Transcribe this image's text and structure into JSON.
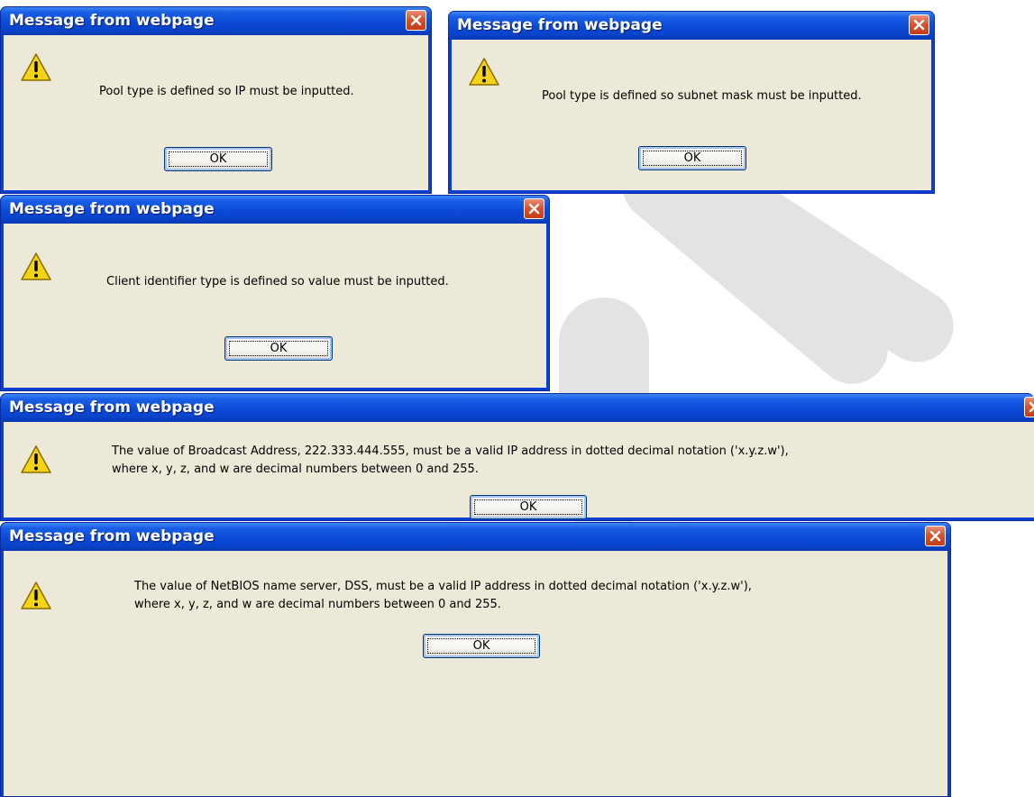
{
  "dialogs": [
    {
      "title": "Message from webpage",
      "message_lines": [
        "Pool type is defined so IP must be inputted."
      ],
      "ok_label": "OK"
    },
    {
      "title": "Message from webpage",
      "message_lines": [
        "Pool type is defined so subnet mask must be inputted."
      ],
      "ok_label": "OK"
    },
    {
      "title": "Message from webpage",
      "message_lines": [
        "Client identifier type is defined so value must be inputted."
      ],
      "ok_label": "OK"
    },
    {
      "title": "Message from webpage",
      "message_lines": [
        "The value of Broadcast Address, 222.333.444.555, must be a valid IP address in dotted decimal notation ('x.y.z.w'),",
        "where x, y, z, and w are decimal numbers between 0 and 255."
      ],
      "ok_label": "OK"
    },
    {
      "title": "Message from webpage",
      "message_lines": [
        "The value of NetBIOS name server, DSS, must be a valid IP address in dotted decimal notation ('x.y.z.w'),",
        "where x, y, z, and w are decimal numbers between 0 and 255."
      ],
      "ok_label": "OK"
    }
  ],
  "icons": {
    "warning": "warning-icon",
    "close": "close-icon"
  },
  "colors": {
    "titlebar": "#0a44cc",
    "dialog_body": "#ece9d8",
    "close_button": "#d9542f",
    "warning_yellow": "#f5d418"
  }
}
